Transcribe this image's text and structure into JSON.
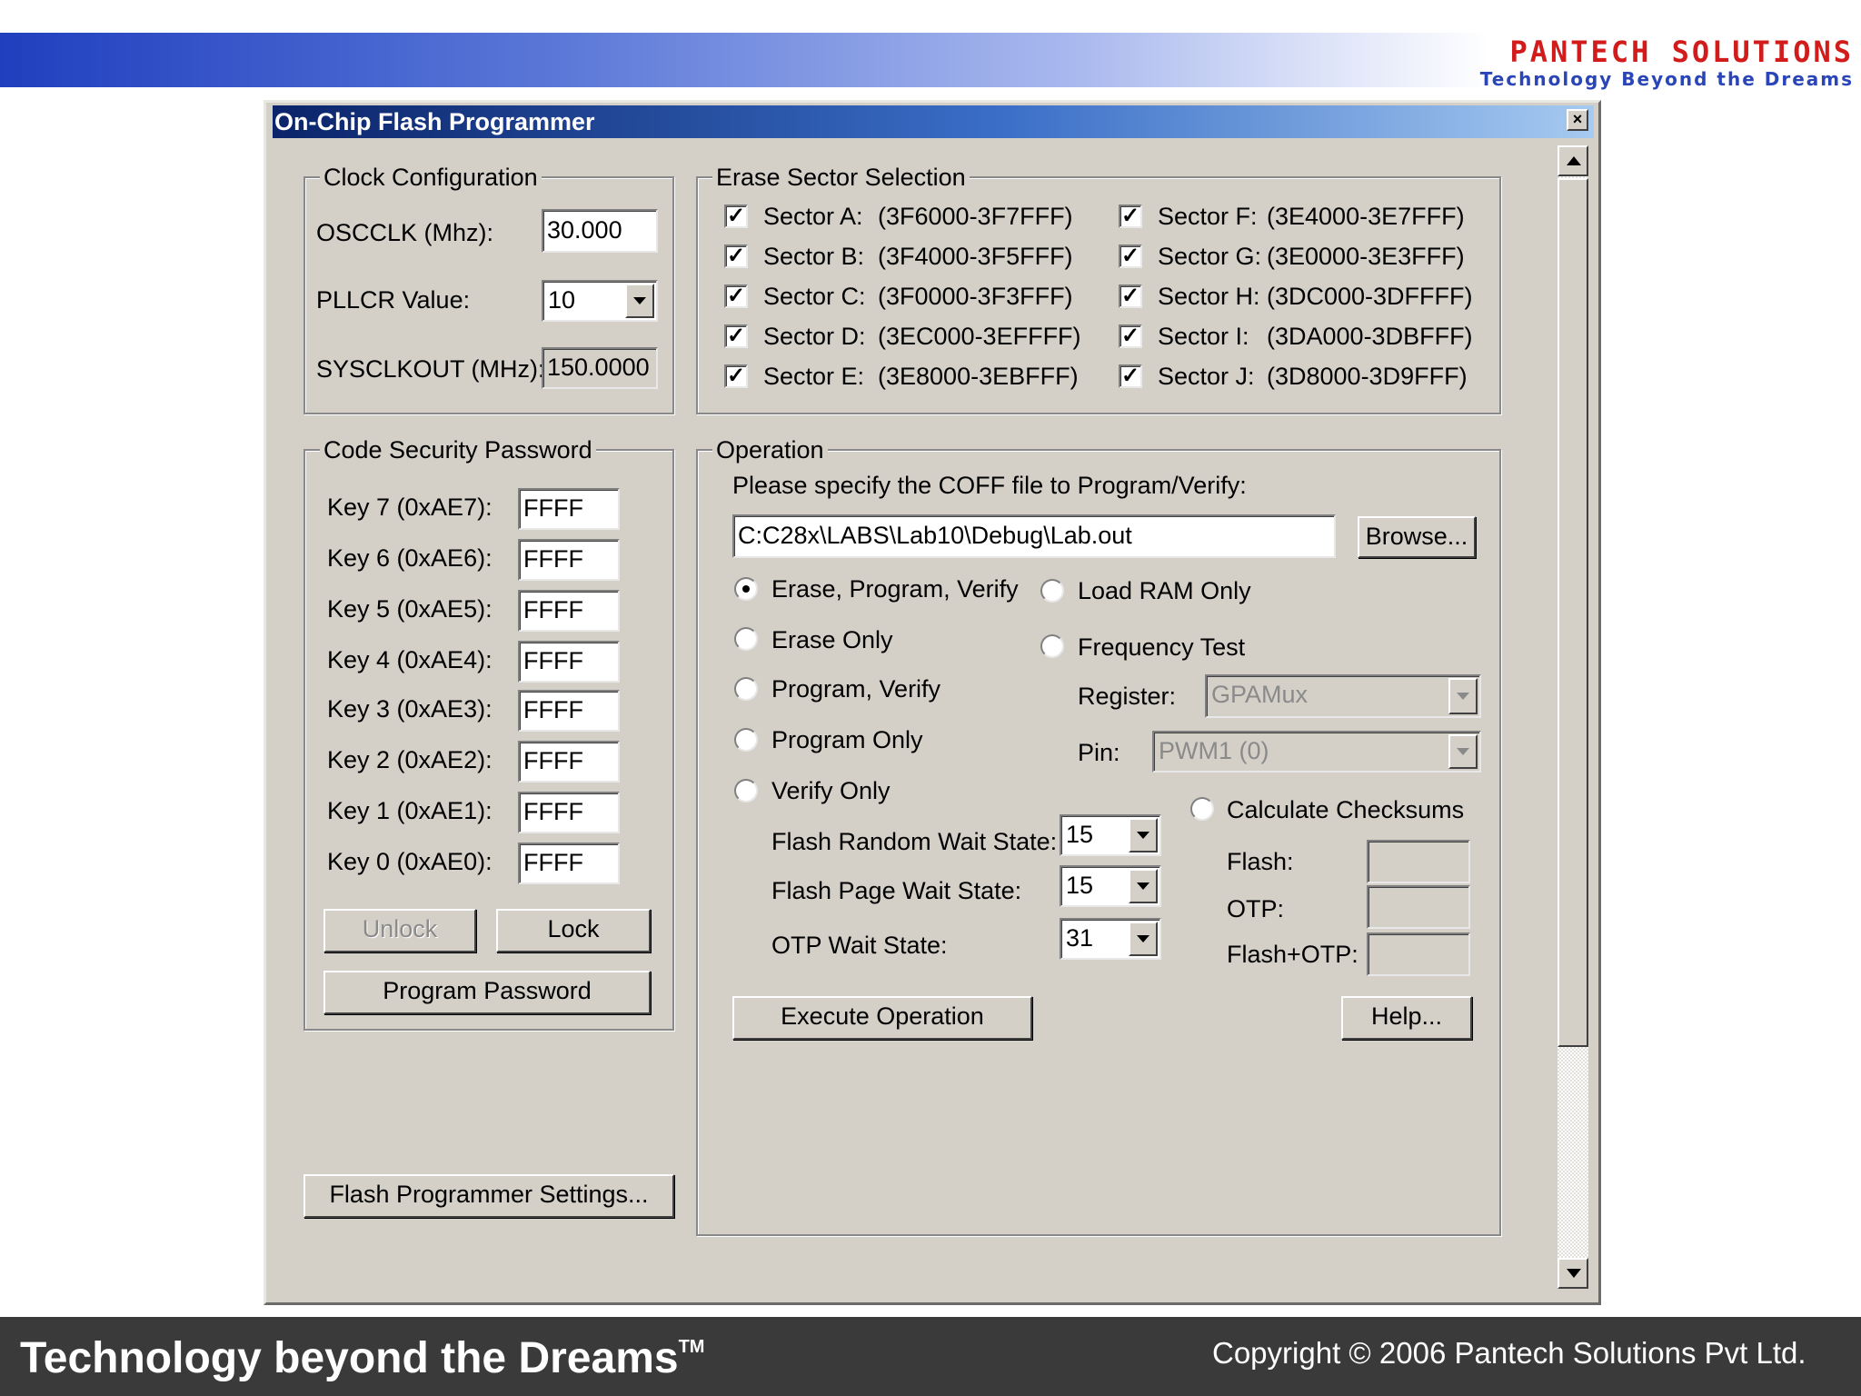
{
  "slide": {
    "brand": "PANTECH SOLUTIONS",
    "brand_tagline": "Technology Beyond the Dreams",
    "footer_tagline": "Technology beyond the Dreams",
    "footer_tm": "TM",
    "footer_copyright": "Copyright © 2006 Pantech Solutions Pvt Ltd."
  },
  "dialog": {
    "title": "On-Chip Flash Programmer",
    "close_glyph": "×"
  },
  "clock": {
    "legend": "Clock Configuration",
    "oscclk_label": "OSCCLK (Mhz):",
    "oscclk_value": "30.000",
    "pllcr_label": "PLLCR Value:",
    "pllcr_value": "10",
    "sysclkout_label": "SYSCLKOUT (MHz):",
    "sysclkout_value": "150.0000"
  },
  "erase": {
    "legend": "Erase Sector Selection",
    "left": [
      {
        "name": "Sector A:",
        "range": "(3F6000-3F7FFF)",
        "checked": true
      },
      {
        "name": "Sector B:",
        "range": "(3F4000-3F5FFF)",
        "checked": true
      },
      {
        "name": "Sector C:",
        "range": "(3F0000-3F3FFF)",
        "checked": true
      },
      {
        "name": "Sector D:",
        "range": "(3EC000-3EFFFF)",
        "checked": true
      },
      {
        "name": "Sector E:",
        "range": "(3E8000-3EBFFF)",
        "checked": true
      }
    ],
    "right": [
      {
        "name": "Sector F:",
        "range": "(3E4000-3E7FFF)",
        "checked": true
      },
      {
        "name": "Sector G:",
        "range": "(3E0000-3E3FFF)",
        "checked": true
      },
      {
        "name": "Sector H:",
        "range": "(3DC000-3DFFFF)",
        "checked": true
      },
      {
        "name": "Sector I:",
        "range": "(3DA000-3DBFFF)",
        "checked": true
      },
      {
        "name": "Sector J:",
        "range": "(3D8000-3D9FFF)",
        "checked": true
      }
    ],
    "check_glyph": "✓"
  },
  "security": {
    "legend": "Code Security Password",
    "keys": [
      {
        "label": "Key 7 (0xAE7):",
        "value": "FFFF"
      },
      {
        "label": "Key 6 (0xAE6):",
        "value": "FFFF"
      },
      {
        "label": "Key 5 (0xAE5):",
        "value": "FFFF"
      },
      {
        "label": "Key 4 (0xAE4):",
        "value": "FFFF"
      },
      {
        "label": "Key 3 (0xAE3):",
        "value": "FFFF"
      },
      {
        "label": "Key 2 (0xAE2):",
        "value": "FFFF"
      },
      {
        "label": "Key 1 (0xAE1):",
        "value": "FFFF"
      },
      {
        "label": "Key 0 (0xAE0):",
        "value": "FFFF"
      }
    ],
    "unlock_label": "Unlock",
    "lock_label": "Lock",
    "program_password_label": "Program Password"
  },
  "settings_button_label": "Flash Programmer Settings...",
  "operation": {
    "legend": "Operation",
    "coff_prompt": "Please specify the COFF file to Program/Verify:",
    "coff_path": "C:C28x\\LABS\\Lab10\\Debug\\Lab.out",
    "browse_label": "Browse...",
    "radios_left": [
      {
        "label": "Erase, Program, Verify",
        "selected": true
      },
      {
        "label": "Erase Only",
        "selected": false
      },
      {
        "label": "Program, Verify",
        "selected": false
      },
      {
        "label": "Program Only",
        "selected": false
      },
      {
        "label": "Verify Only",
        "selected": false
      }
    ],
    "load_ram_label": "Load RAM Only",
    "freq_test_label": "Frequency Test",
    "register_label": "Register:",
    "register_value": "GPAMux",
    "pin_label": "Pin:",
    "pin_value": "PWM1 (0)",
    "flash_random_label": "Flash Random Wait State:",
    "flash_random_value": "15",
    "flash_page_label": "Flash Page Wait State:",
    "flash_page_value": "15",
    "otp_wait_label": "OTP Wait State:",
    "otp_wait_value": "31",
    "checksum_label": "Calculate Checksums",
    "flash_label": "Flash:",
    "otp_label": "OTP:",
    "flash_otp_label": "Flash+OTP:",
    "flash_value": "",
    "otp_value": "",
    "flash_otp_value": "",
    "execute_label": "Execute Operation",
    "help_label": "Help..."
  }
}
